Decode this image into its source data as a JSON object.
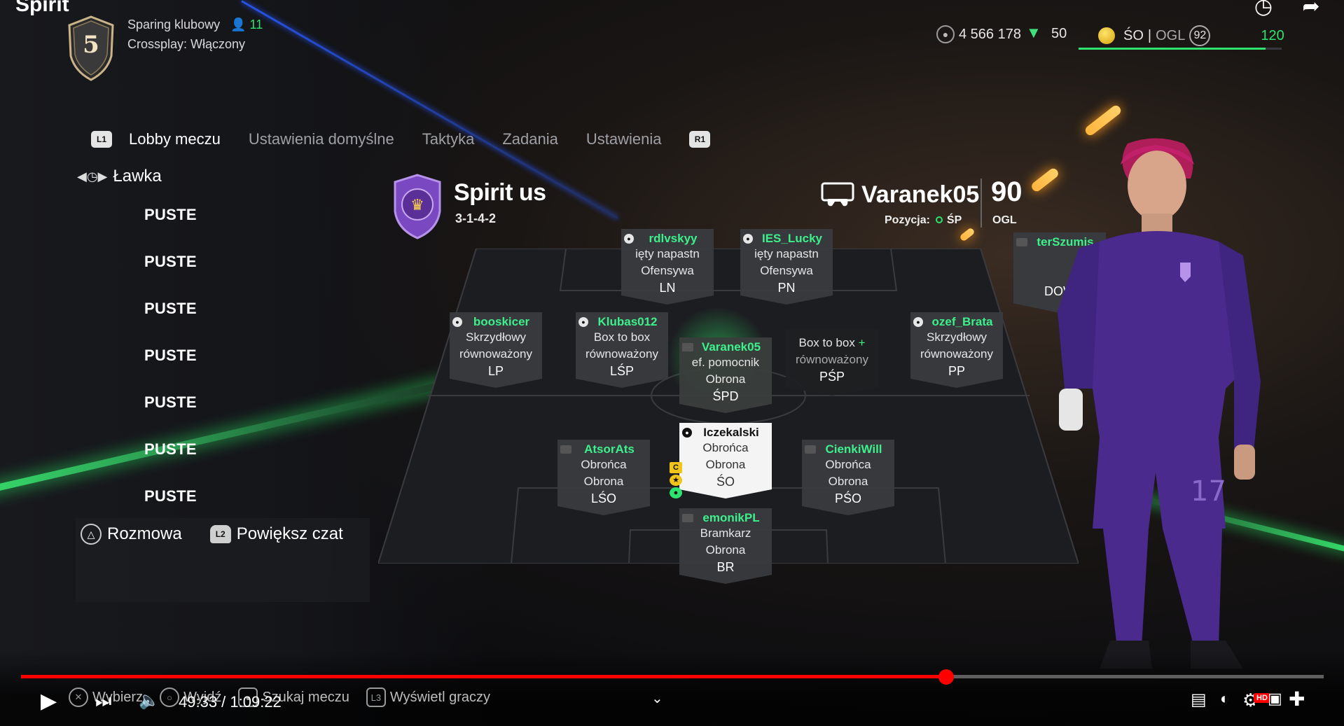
{
  "top": {
    "title": "Spirit",
    "rank": "5",
    "mode": "Sparing klubowy",
    "online_count": "11",
    "crossplay": "Crossplay: Włączony"
  },
  "currency": {
    "coins": "4 566 178",
    "points": "50",
    "position": "ŚO",
    "ovr_label": "OGL",
    "ovr": "92",
    "xp": "120",
    "xp_progress": 0.92
  },
  "tabs": {
    "left_button": "L1",
    "right_button": "R1",
    "items": [
      "Lobby meczu",
      "Ustawienia domyślne",
      "Taktyka",
      "Zadania",
      "Ustawienia"
    ]
  },
  "bench": {
    "title": "Ławka",
    "items": [
      "PUSTE",
      "PUSTE",
      "PUSTE",
      "PUSTE",
      "PUSTE",
      "PUSTE",
      "PUSTE"
    ]
  },
  "actions": {
    "chat": "Rozmowa",
    "expand_chat": "Powiększ czat"
  },
  "club": {
    "name": "Spirit us",
    "formation": "3-1-4-2"
  },
  "player": {
    "name": "Varanek05",
    "position_label": "Pozycja:",
    "position": "ŚP",
    "ovr": "90",
    "ovr_label": "OGL"
  },
  "lineup": {
    "ln": {
      "name": "rdlvskyy",
      "l1": "ięty napastn",
      "l2": "Ofensywa",
      "pos": "LN"
    },
    "pn": {
      "name": "IES_Lucky",
      "l1": "ięty napastn",
      "l2": "Ofensywa",
      "pos": "PN"
    },
    "dow": {
      "name": "terSzumis",
      "pos": "DOW"
    },
    "lp": {
      "name": "booskicer",
      "l1": "Skrzydłowy",
      "l2": "równoważony",
      "pos": "LP"
    },
    "lsp": {
      "name": "Klubas012",
      "l1": "Box to box",
      "l2": "równoważony",
      "pos": "LŚP"
    },
    "sdp": {
      "name": "Varanek05",
      "l1": "ef. pomocnik",
      "l2": "Obrona",
      "pos": "ŚPD"
    },
    "psp": {
      "l1": "Box to box",
      "l2": "równoważony",
      "pos": "PŚP"
    },
    "pp": {
      "name": "ozef_Brata",
      "l1": "Skrzydłowy",
      "l2": "równoważony",
      "pos": "PP"
    },
    "lso": {
      "name": "AtsorAts",
      "l1": "Obrońca",
      "l2": "Obrona",
      "pos": "LŚO"
    },
    "so": {
      "name": "Iczekalski",
      "l1": "Obrońca",
      "l2": "Obrona",
      "pos": "ŚO"
    },
    "pso": {
      "name": "CienkiWill",
      "l1": "Obrońca",
      "l2": "Obrona",
      "pos": "PŚO"
    },
    "br": {
      "name": "emonikPL",
      "l1": "Bramkarz",
      "l2": "Obrona",
      "pos": "BR"
    },
    "captain_badge": "C"
  },
  "hints": {
    "select": "Wybierz",
    "back": "Wyjdź",
    "search": "Szukaj meczu",
    "show_players": "Wyświetl graczy"
  },
  "video": {
    "time": "49:33 / 1:09:22",
    "progress": 0.71,
    "hd": "HD"
  },
  "colors": {
    "accent_green": "#3df08b",
    "progress_red": "#ff0000",
    "club_purple": "#6b3fa8"
  }
}
